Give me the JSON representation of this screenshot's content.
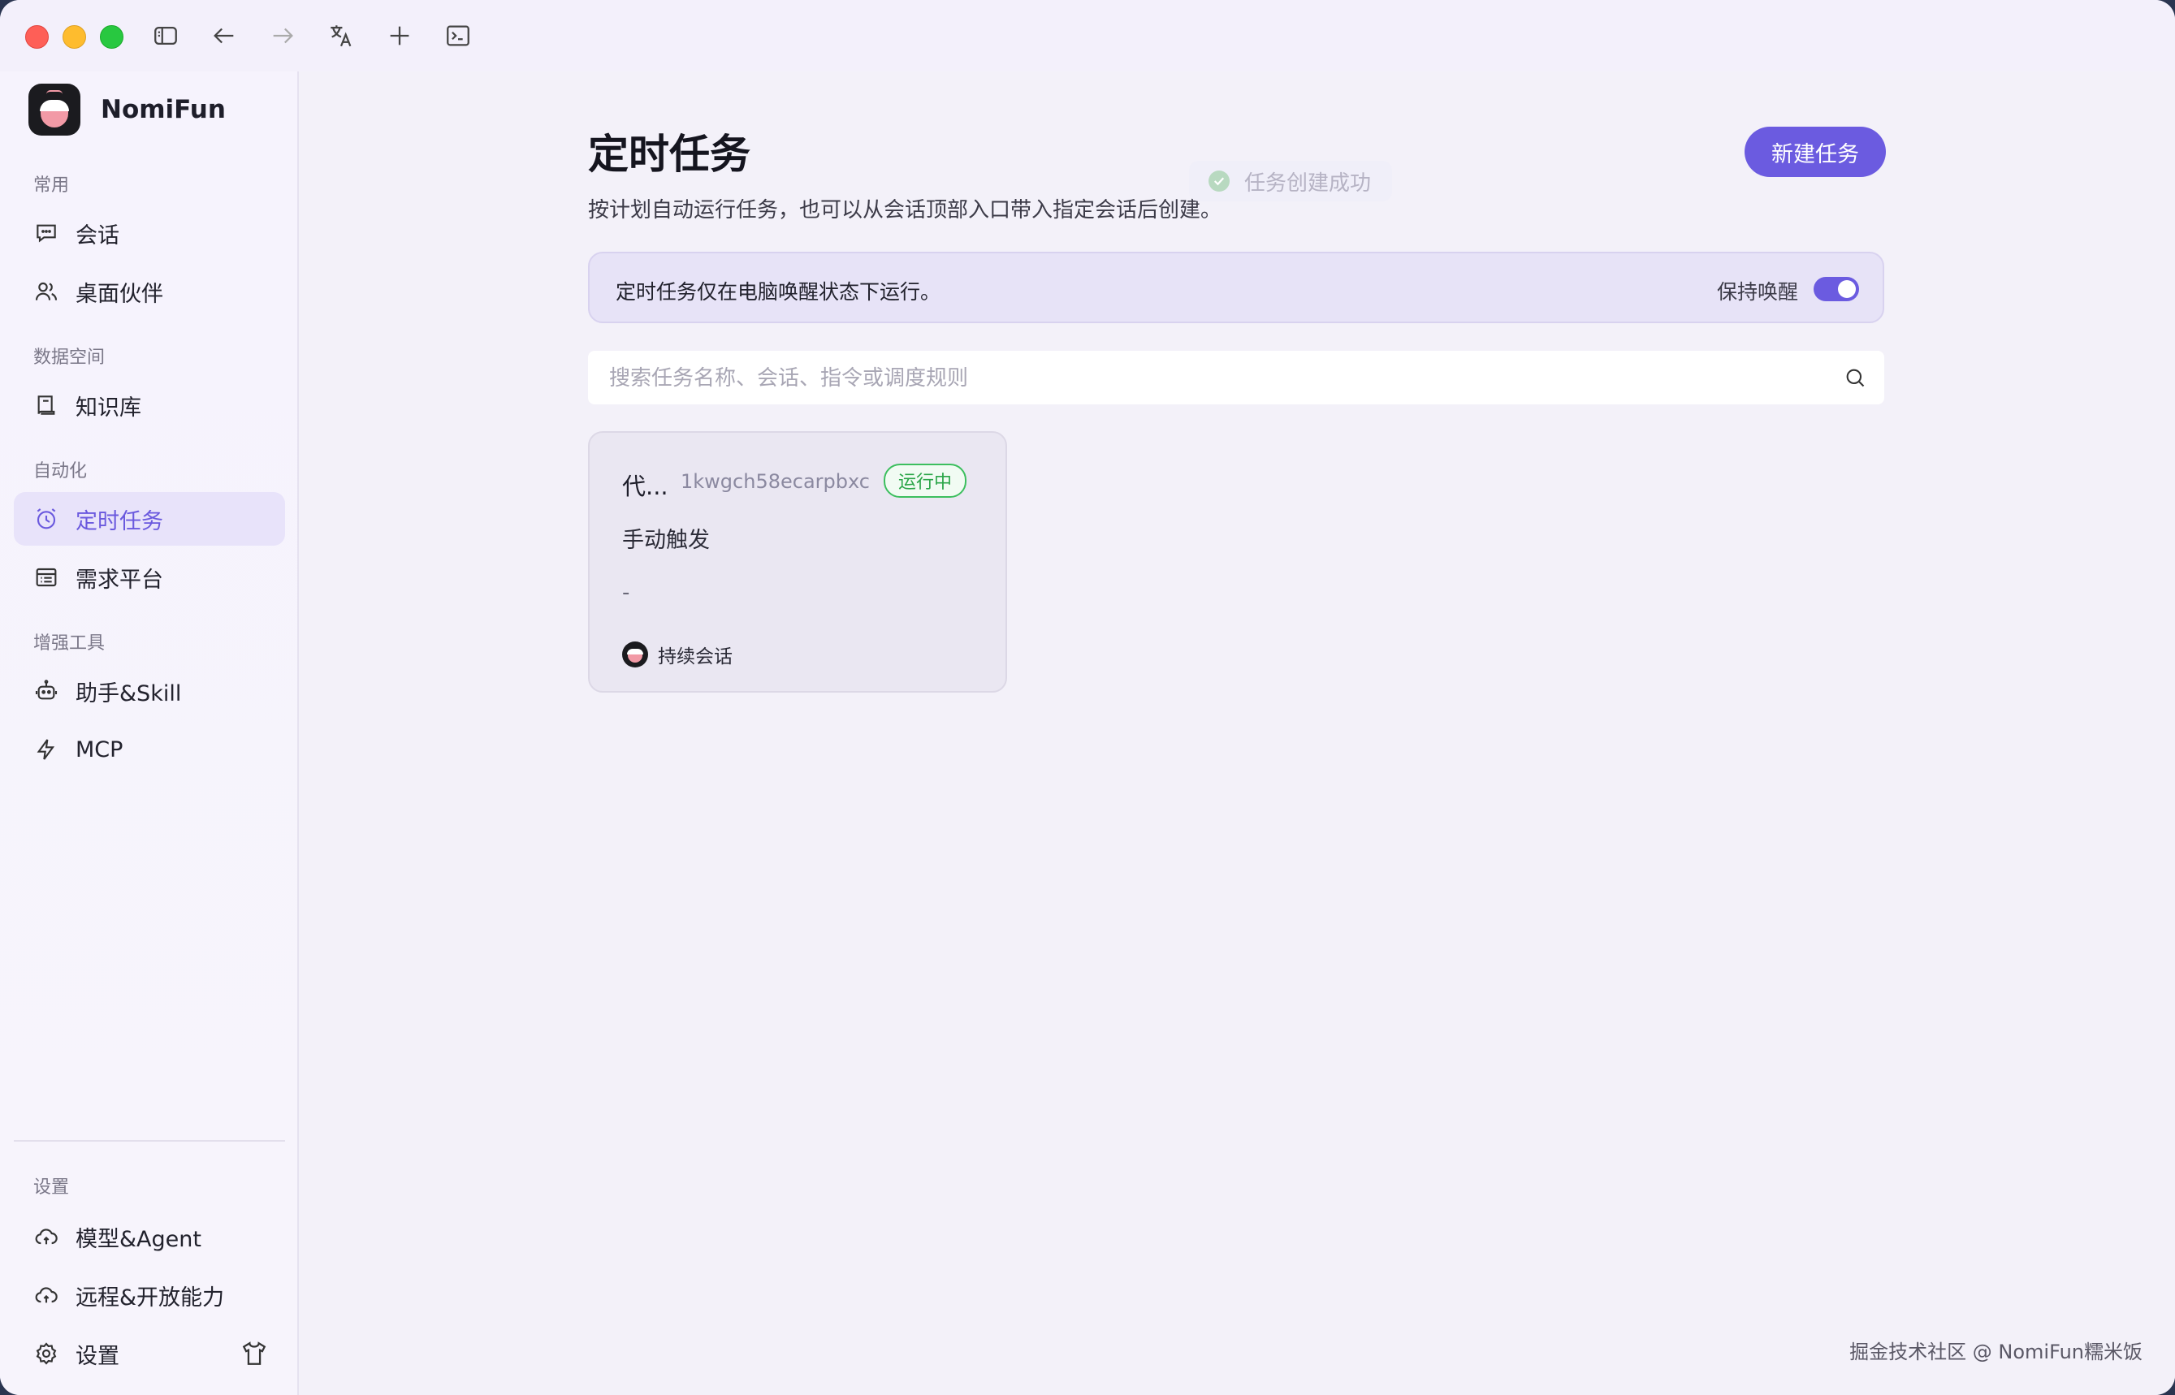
{
  "app": {
    "name": "NomiFun"
  },
  "sidebar": {
    "sections": [
      {
        "label": "常用",
        "items": [
          {
            "label": "会话",
            "icon": "chat-icon"
          },
          {
            "label": "桌面伙伴",
            "icon": "users-icon"
          }
        ]
      },
      {
        "label": "数据空间",
        "items": [
          {
            "label": "知识库",
            "icon": "book-icon"
          }
        ]
      },
      {
        "label": "自动化",
        "items": [
          {
            "label": "定时任务",
            "icon": "clock-icon",
            "active": true
          },
          {
            "label": "需求平台",
            "icon": "list-icon"
          }
        ]
      },
      {
        "label": "增强工具",
        "items": [
          {
            "label": "助手&Skill",
            "icon": "robot-icon"
          },
          {
            "label": "MCP",
            "icon": "bolt-icon"
          }
        ]
      }
    ],
    "settings": {
      "label": "设置",
      "items": [
        {
          "label": "模型&Agent",
          "icon": "cloud-icon"
        },
        {
          "label": "远程&开放能力",
          "icon": "cloud-icon"
        },
        {
          "label": "设置",
          "icon": "gear-icon"
        }
      ]
    }
  },
  "page": {
    "title": "定时任务",
    "subtitle": "按计划自动运行任务，也可以从会话顶部入口带入指定会话后创建。",
    "new_button": "新建任务",
    "toast": "任务创建成功",
    "banner": {
      "text": "定时任务仅在电脑唤醒状态下运行。",
      "keep_awake_label": "保持唤醒",
      "keep_awake_on": true
    },
    "search": {
      "placeholder": "搜索任务名称、会话、指令或调度规则",
      "value": ""
    },
    "tasks": [
      {
        "title": "代...",
        "id": "1kwgch58ecarpbxc",
        "status": "运行中",
        "trigger": "手动触发",
        "detail": "-",
        "session": "持续会话"
      }
    ]
  },
  "watermark": "掘金技术社区 @ NomiFun糯米饭",
  "colors": {
    "accent": "#6b5be0",
    "status_green": "#2aa548",
    "sidebar_active_bg": "#e8e3fa"
  }
}
